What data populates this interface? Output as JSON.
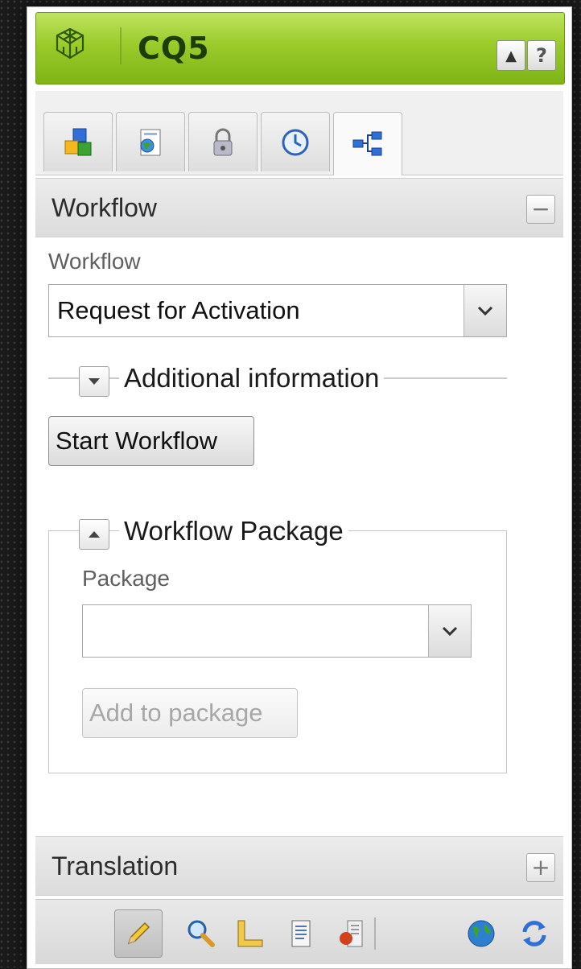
{
  "header": {
    "brand": "CQ5",
    "collapse_glyph": "▲",
    "help_glyph": "?"
  },
  "tabs": [
    {
      "icon": "components-icon"
    },
    {
      "icon": "page-icon"
    },
    {
      "icon": "lock-icon"
    },
    {
      "icon": "clock-icon"
    },
    {
      "icon": "workflow-icon",
      "active": true
    }
  ],
  "workflow_section": {
    "title": "Workflow",
    "toggle": "−",
    "field_label": "Workflow",
    "field_value": "Request for Activation",
    "additional_info_label": "Additional information",
    "start_button": "Start Workflow",
    "package_group": {
      "legend": "Workflow Package",
      "package_label": "Package",
      "package_value": "",
      "add_button": "Add to package"
    }
  },
  "translation_section": {
    "title": "Translation",
    "toggle": "+"
  },
  "bottom_toolbar": [
    {
      "icon": "pencil-icon",
      "selected": true
    },
    {
      "icon": "magnifier-icon"
    },
    {
      "icon": "ruler-icon"
    },
    {
      "icon": "document-icon"
    },
    {
      "icon": "page-properties-icon"
    },
    {
      "icon": "globe-icon"
    },
    {
      "icon": "refresh-icon"
    }
  ]
}
